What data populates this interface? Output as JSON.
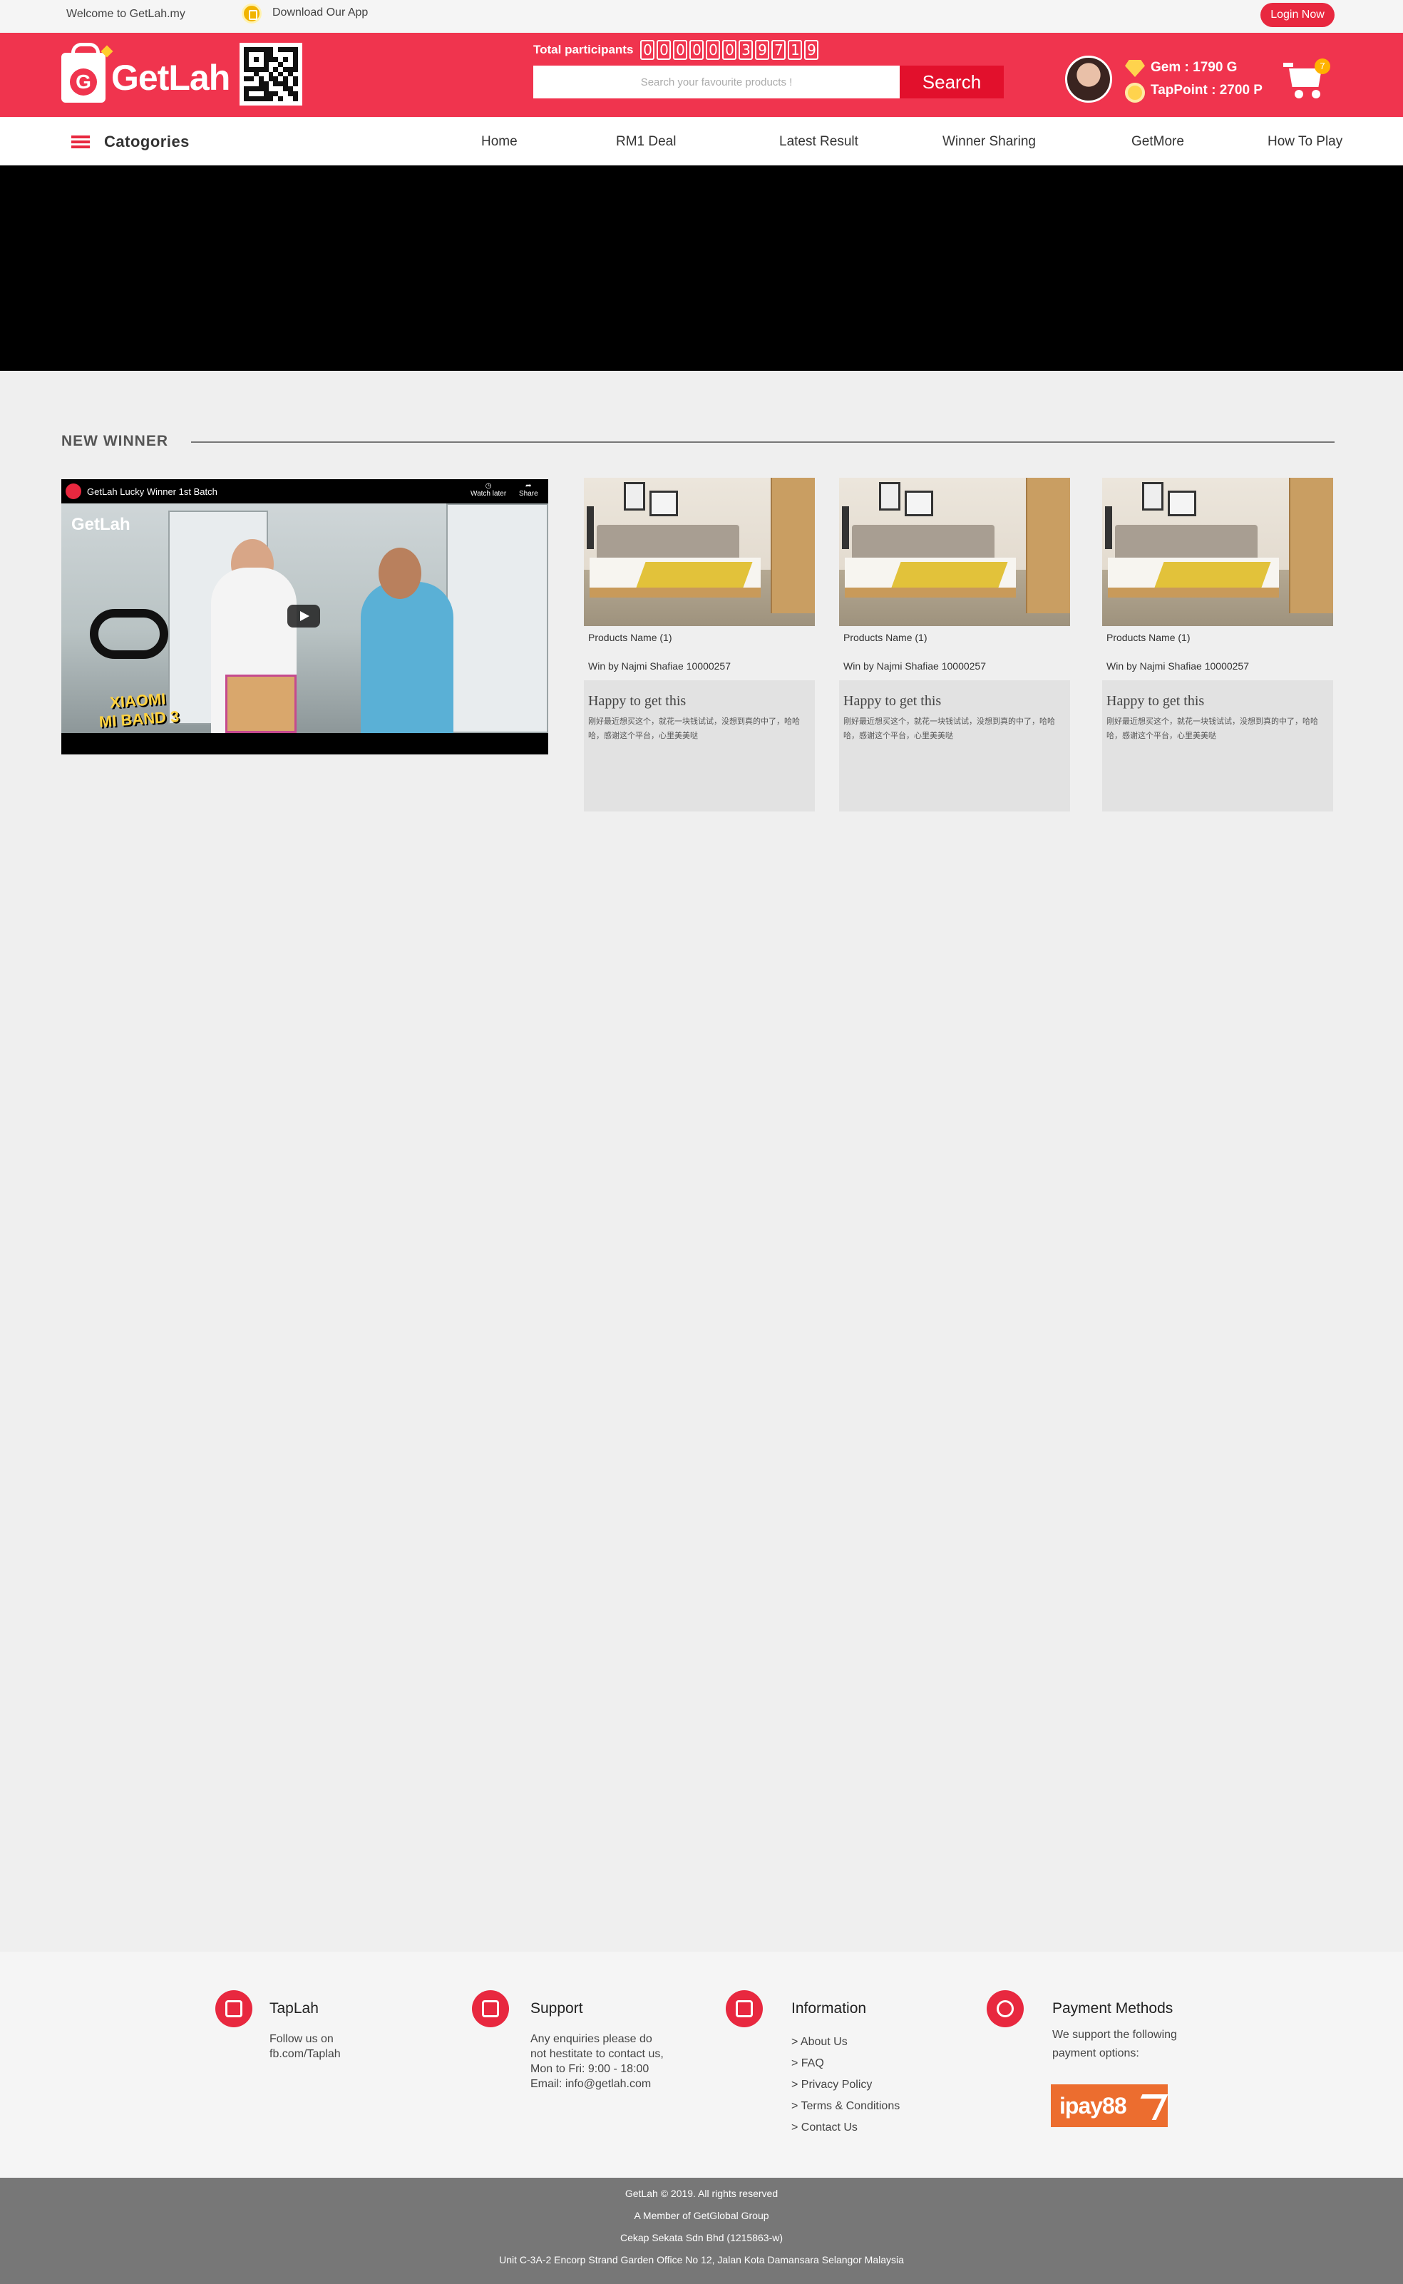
{
  "topbar": {
    "welcome": "Welcome to GetLah.my",
    "download": "Download Our App",
    "login": "Login Now"
  },
  "header": {
    "logo_text": "GetLah",
    "participants_label": "Total participants",
    "participants_digits": [
      "0",
      "0",
      "0",
      "0",
      "0",
      "0",
      "3",
      "9",
      "7",
      "1",
      "9"
    ],
    "search_placeholder": "Search your favourite products !",
    "search_button": "Search",
    "gem": "Gem : 1790 G",
    "tappoint": "TapPoint : 2700 P",
    "cart_count": "7"
  },
  "nav": {
    "categories": "Catogories",
    "items": [
      "Home",
      "RM1 Deal",
      "Latest Result",
      "Winner Sharing",
      "GetMore",
      "How To Play"
    ]
  },
  "new_winner": {
    "title": "NEW WINNER",
    "video": {
      "title": "GetLah Lucky Winner 1st Batch",
      "watch_later": "Watch later",
      "share": "Share",
      "brand": "GetLah",
      "overlay_line1": "XIAOMI",
      "overlay_line2": "MI BAND 3"
    },
    "cards": [
      {
        "product": "Products Name (1)",
        "winner": "Win by Najmi Shafiae 10000257",
        "heading": "Happy to get this",
        "text": "刚好最近想买这个，就花一块钱试试，没想到真的中了，哈哈哈，感谢这个平台，心里美美哒"
      },
      {
        "product": "Products Name (1)",
        "winner": "Win by Najmi Shafiae 10000257",
        "heading": "Happy to get this",
        "text": "刚好最近想买这个，就花一块钱试试，没想到真的中了，哈哈哈，感谢这个平台，心里美美哒"
      },
      {
        "product": "Products Name (1)",
        "winner": "Win by Najmi Shafiae 10000257",
        "heading": "Happy to get this",
        "text": "刚好最近想买这个，就花一块钱试试，没想到真的中了，哈哈哈，感谢这个平台，心里美美哒"
      }
    ]
  },
  "footer": {
    "taplah": {
      "title": "TapLah",
      "line1": "Follow us on",
      "line2": "fb.com/Taplah"
    },
    "support": {
      "title": "Support",
      "line1": "Any enquiries please do",
      "line2": "not hestitate to contact us,",
      "line3": "Mon to Fri: 9:00 - 18:00",
      "line4": "Email: info@getlah.com"
    },
    "information": {
      "title": "Information",
      "links": [
        "> About Us",
        "> FAQ",
        "> Privacy Policy",
        "> Terms & Conditions",
        "> Contact Us"
      ]
    },
    "payment": {
      "title": "Payment Methods",
      "line1": "We support the following",
      "line2": "payment options:",
      "logo": "ipay88"
    },
    "bottom": [
      "GetLah © 2019. All rights reserved",
      "A Member of GetGlobal Group",
      "Cekap Sekata Sdn Bhd (1215863-w)",
      "Unit C-3A-2 Encorp Strand Garden Office No 12, Jalan Kota Damansara Selangor Malaysia"
    ]
  },
  "colors": {
    "brand": "#f0344e",
    "accent": "#e8283f",
    "search_button": "#e2102c"
  }
}
